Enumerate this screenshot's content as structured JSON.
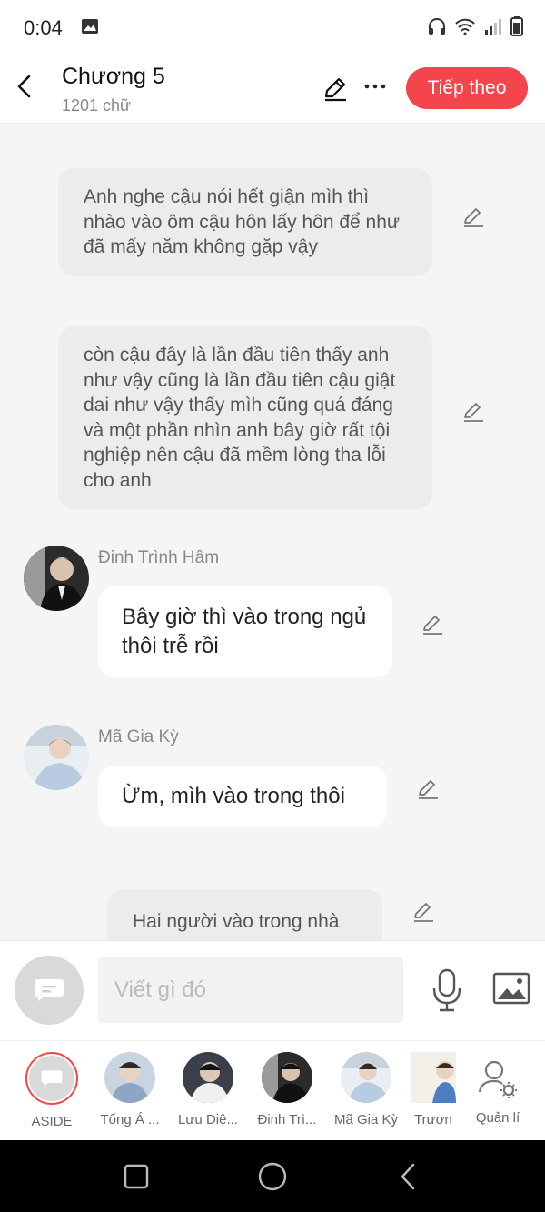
{
  "status_bar": {
    "time": "0:04"
  },
  "header": {
    "title": "Chương 5",
    "word_count": "1201 chữ",
    "next_label": "Tiếp theo"
  },
  "messages": [
    {
      "type": "narration",
      "text": "Anh nghe cậu nói hết giận mìh thì nhào vào ôm cậu hôn lấy hôn để như đã mấy năm không gặp vậy"
    },
    {
      "type": "narration",
      "text": "còn cậu đây là lần đầu tiên thấy anh như vậy cũng là lần đầu tiên cậu giật dai như vậy thấy mìh cũng quá đáng và một phần nhìn anh bây giờ rất   tội nghiệp nên cậu đã mềm lòng tha lỗi cho anh"
    },
    {
      "type": "dialogue",
      "speaker": "Đinh Trình Hâm",
      "text": "Bây giờ thì vào trong ngủ thôi trễ rồi"
    },
    {
      "type": "dialogue",
      "speaker": "Mã Gia Kỳ",
      "text": "Ừm, mìh vào trong thôi"
    },
    {
      "type": "narration",
      "text": "Hai người vào trong nhà"
    }
  ],
  "input": {
    "placeholder": "Viết gì đó"
  },
  "characters": [
    {
      "label": "ASIDE"
    },
    {
      "label": "Tống Á ..."
    },
    {
      "label": "Lưu Diệ..."
    },
    {
      "label": "Đinh Trì..."
    },
    {
      "label": "Mã Gia Kỳ"
    },
    {
      "label": "Trươn"
    },
    {
      "label": "Quản lí"
    }
  ],
  "colors": {
    "accent": "#f3454b",
    "background": "#f5f5f5",
    "narration_bubble": "#ececec"
  }
}
